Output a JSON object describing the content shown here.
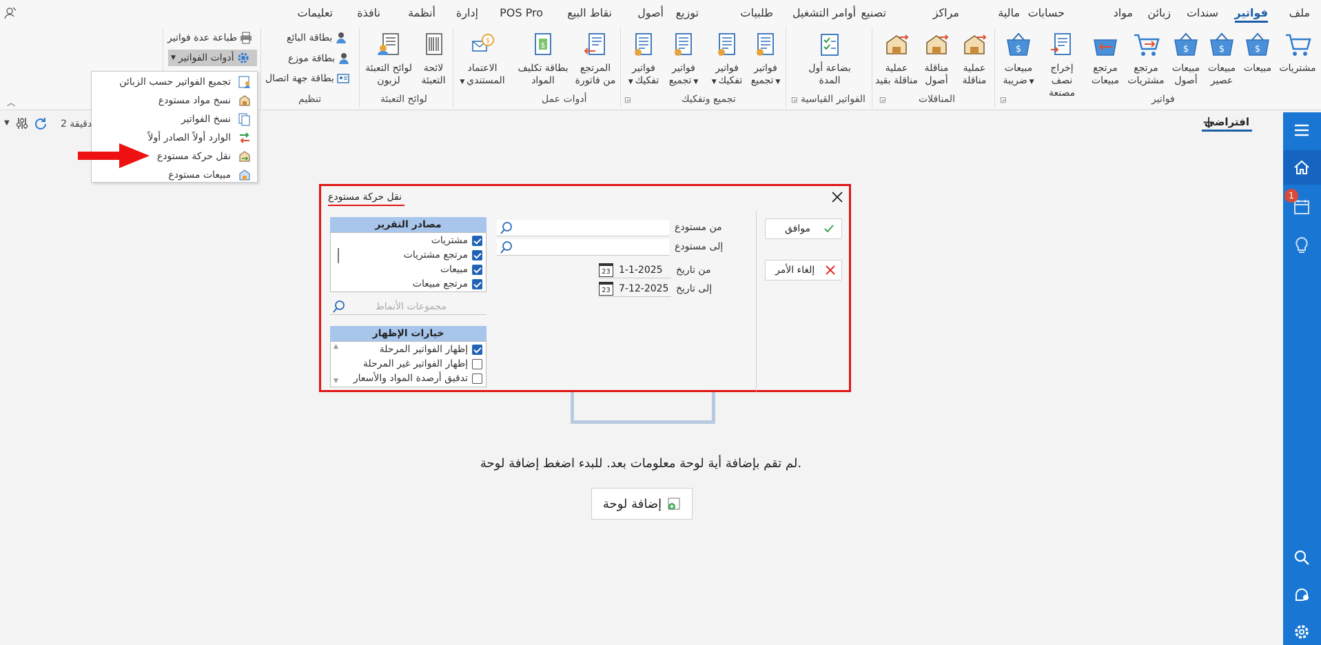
{
  "menu": {
    "items": [
      "ملف",
      "فواتير",
      "سندات",
      "زبائن",
      "مواد",
      "حسابات",
      "مالية",
      "مراكز",
      "تصنيع",
      "أوامر التشغيل",
      "طلبيات",
      "توزيع",
      "أصول",
      "نقاط البيع",
      "POS Pro",
      "إدارة",
      "أنظمة",
      "نافذة",
      "تعليمات"
    ],
    "active": "فواتير"
  },
  "ribbon": {
    "buttons": {
      "b1": [
        "مشتريات"
      ],
      "b2": [
        "مبيعات"
      ],
      "b3": [
        "مبيعات",
        "عصير"
      ],
      "b4": [
        "مبيعات",
        "أصول"
      ],
      "b5": [
        "مرتجع",
        "مشتريات"
      ],
      "b6": [
        "مرتجع",
        "مبيعات"
      ],
      "b7": [
        "إخراج نصف",
        "مصنعة"
      ],
      "b8": [
        "مبيعات",
        "ضريبة"
      ],
      "b9": [
        "عملية",
        "مناقلة"
      ],
      "b10": [
        "مناقلة",
        "أصول"
      ],
      "b11": [
        "عملية",
        "مناقلة بقيد"
      ],
      "b12": [
        "بضاعة أول",
        "المدة"
      ],
      "b13": [
        "فواتير",
        "تجميع"
      ],
      "b14": [
        "فواتير",
        "تفكيك"
      ],
      "b15": [
        "فواتير",
        "تجميع"
      ],
      "b16": [
        "فواتير",
        "تفكيك"
      ],
      "b17": [
        "المرتجع",
        "من فاتورة"
      ],
      "b18": [
        "بطاقة تكليف",
        "المواد"
      ],
      "b19": [
        "الاعتماد",
        "المستندي"
      ],
      "b20": [
        "لائحة",
        "التعبئة"
      ],
      "b21": [
        "لوائح التعبئة",
        "لزبون"
      ]
    },
    "small": {
      "seller_card": "بطاقة البائع",
      "distributor_card": "بطاقة موزع",
      "contact_card": "بطاقة جهة اتصال",
      "print_invoices": "طباعة عدة فواتير",
      "invoice_tools": "أدوات الفواتير"
    },
    "groups": {
      "invoices": "فواتير",
      "transfers": "المناقلات",
      "standard": "الفواتير القياسية",
      "assembly": "تجميع وتفكيك",
      "work_tools": "أدوات عمل",
      "packing": "لوائح التعبئة",
      "organize": "تنظيم"
    }
  },
  "dropdown": {
    "items": [
      "تجميع الفواتير حسب الزبائن",
      "نسخ مواد مستودع",
      "نسخ الفواتير",
      "الوارد أولاً الصادر أولاً",
      "نقل حركة مستودع",
      "مبيعات مستودع"
    ]
  },
  "tabbar": {
    "tab": "افتراضي",
    "refresh_text": "2 دقيقة"
  },
  "dashboard": {
    "empty_message": "لم تقم بإضافة أية لوحة معلومات بعد. للبدء اضغط إضافة لوحة.",
    "add_button": "إضافة لوحة"
  },
  "sidebar": {
    "badge": "1"
  },
  "dialog": {
    "title": "نقل حركة مستودع",
    "ok": "موافق",
    "cancel": "إلغاء الأمر",
    "from_warehouse_label": "من مستودع",
    "to_warehouse_label": "إلى مستودع",
    "from_warehouse_value": "",
    "to_warehouse_value": "",
    "from_date_label": "من تاريخ",
    "to_date_label": "إلى تاريخ",
    "from_date": "1-1-2025",
    "to_date": "7-12-2025",
    "calendar_day": "23",
    "sources_header": "مصادر التقرير",
    "sources": [
      {
        "label": "مشتريات",
        "checked": true
      },
      {
        "label": "مرتجع مشتريات",
        "checked": true
      },
      {
        "label": "مبيعات",
        "checked": true
      },
      {
        "label": "مرتجع مبيعات",
        "checked": true
      }
    ],
    "pattern_groups_placeholder": "مجموعات الأنماط",
    "display_header": "خيارات الإظهار",
    "display_options": [
      {
        "label": "إظهار الفواتير المرحلة",
        "checked": true
      },
      {
        "label": "إظهار الفواتير غير المرحلة",
        "checked": false
      },
      {
        "label": "تدقيق أرصدة المواد والأسعار",
        "checked": false
      }
    ]
  },
  "colors": {
    "accent": "#1976d2",
    "highlight": "#e01414",
    "header": "#a8c6ec"
  }
}
